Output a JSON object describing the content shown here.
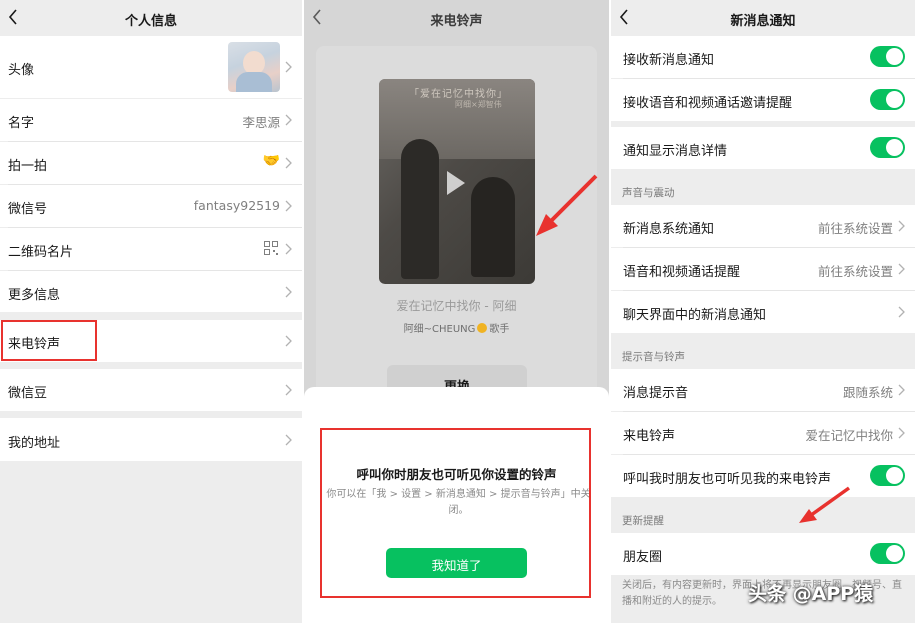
{
  "screen1": {
    "title": "个人信息",
    "rows": [
      {
        "label": "头像",
        "value": ""
      },
      {
        "label": "名字",
        "value": "李思源"
      },
      {
        "label": "拍一拍",
        "value": "🤝"
      },
      {
        "label": "微信号",
        "value": "fantasy92519"
      },
      {
        "label": "二维码名片",
        "value": ""
      },
      {
        "label": "更多信息",
        "value": ""
      },
      {
        "label": "来电铃声",
        "value": ""
      },
      {
        "label": "微信豆",
        "value": ""
      },
      {
        "label": "我的地址",
        "value": ""
      }
    ]
  },
  "screen2": {
    "title": "来电铃声",
    "cover_banner": "「爱在记忆中找你」",
    "cover_sub": "阿细×郑智伟",
    "song_title": "爱在记忆中找你 - 阿细",
    "artist": "阿细~CHEUNG",
    "artist_tag": "歌手",
    "change_button": "更换",
    "dialog": {
      "title": "呼叫你时朋友也可听见你设置的铃声",
      "description": "你可以在「我 > 设置 > 新消息通知 > 提示音与铃声」中关闭。",
      "confirm": "我知道了"
    }
  },
  "screen3": {
    "title": "新消息通知",
    "toggles_top": [
      {
        "label": "接收新消息通知",
        "on": true
      },
      {
        "label": "接收语音和视频通话邀请提醒",
        "on": true
      }
    ],
    "detail_toggle": {
      "label": "通知显示消息详情",
      "on": true
    },
    "sound_section": "声音与震动",
    "sound_rows": [
      {
        "label": "新消息系统通知",
        "value": "前往系统设置"
      },
      {
        "label": "语音和视频通话提醒",
        "value": "前往系统设置"
      },
      {
        "label": "聊天界面中的新消息通知",
        "value": ""
      }
    ],
    "ring_section": "提示音与铃声",
    "ring_rows": [
      {
        "label": "消息提示音",
        "value": "跟随系统"
      },
      {
        "label": "来电铃声",
        "value": "爱在记忆中找你"
      }
    ],
    "ring_toggle": {
      "label": "呼叫我时朋友也可听见我的来电铃声",
      "on": true
    },
    "update_section": "更新提醒",
    "moments_toggle": {
      "label": "朋友圈",
      "on": true
    },
    "footer_note": "关闭后，有内容更新时，界面上将不再显示朋友圈、视频号、直播和附近的人的提示。",
    "watermark": "头条 @APP猿"
  },
  "colors": {
    "accent": "#07c160",
    "highlight": "#e8322e",
    "background": "#ededed"
  }
}
